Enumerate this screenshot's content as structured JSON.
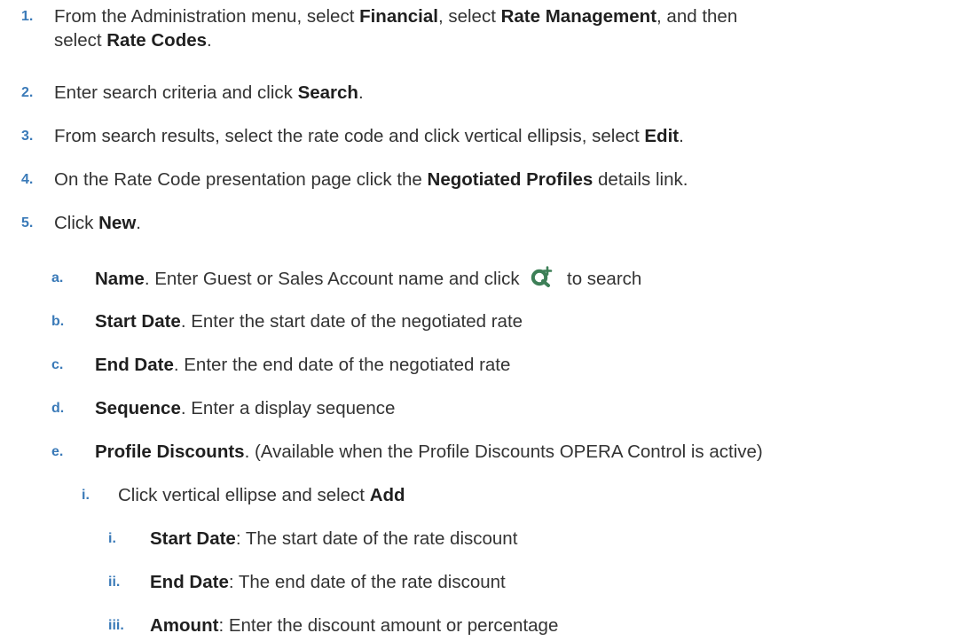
{
  "steps": [
    {
      "marker": "1.",
      "parts": [
        "From the Administration menu, select ",
        "Financial",
        ", select ",
        "Rate Management",
        ", and then",
        "select ",
        "Rate Codes",
        "."
      ]
    },
    {
      "marker": "2.",
      "parts": [
        "Enter search criteria and click ",
        "Search",
        "."
      ]
    },
    {
      "marker": "3.",
      "parts": [
        "From search results, select the rate code and click vertical ellipsis, select ",
        "Edit",
        "."
      ]
    },
    {
      "marker": "4.",
      "parts": [
        "On the Rate Code presentation page click the ",
        "Negotiated Profiles",
        " details link."
      ]
    },
    {
      "marker": "5.",
      "parts": [
        "Click ",
        "New",
        "."
      ]
    }
  ],
  "substeps": [
    {
      "marker": "a.",
      "term": "Name",
      "text": ". Enter Guest or Sales Account name and click ",
      "icon": "search-add-icon",
      "after": " to search"
    },
    {
      "marker": "b.",
      "term": "Start Date",
      "text": ". Enter the start date of the negotiated rate"
    },
    {
      "marker": "c.",
      "term": "End Date",
      "text": ". Enter the end date of the negotiated rate"
    },
    {
      "marker": "d.",
      "term": "Sequence",
      "text": ". Enter a display sequence"
    },
    {
      "marker": "e.",
      "term": "Profile Discounts",
      "text": ". (Available when the Profile Discounts OPERA Control is active)"
    }
  ],
  "sub_i": {
    "marker": "i.",
    "text": "Click vertical ellipse and select ",
    "term": "Add"
  },
  "details": [
    {
      "marker": "i.",
      "term": "Start Date",
      "text": ": The start date of the rate discount"
    },
    {
      "marker": "ii.",
      "term": "End Date",
      "text": ": The end date of the rate discount"
    },
    {
      "marker": "iii.",
      "term": "Amount",
      "text": ": Enter the discount amount or percentage"
    }
  ],
  "colors": {
    "marker": "#3a7ab8",
    "text": "#333333",
    "icon": "#3d7f57"
  }
}
